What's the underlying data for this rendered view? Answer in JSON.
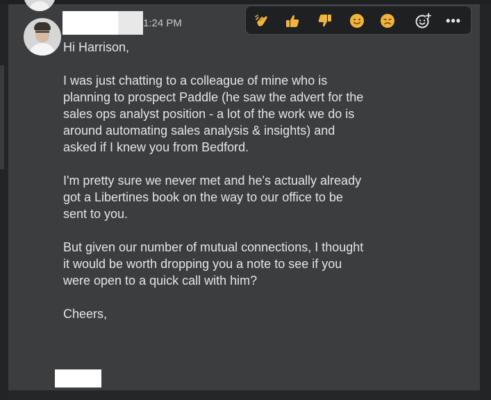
{
  "message": {
    "timestamp": "1:24 PM",
    "greeting": "Hi Harrison,",
    "paragraphs": [
      "I was just chatting to a colleague of mine who is\nplanning to prospect Paddle (he saw the advert for the\nsales ops analyst position - a lot of the work we do is\naround automating sales analysis & insights) and\nasked if I knew you from Bedford.",
      "I'm pretty sure we never met and he's actually already\ngot a Libertines book on the way to our office to be\nsent to you.",
      "But given our number of mutual connections, I thought\nit would be worth dropping you a note to see if you\nwere open to a quick call with him?"
    ],
    "signoff": "Cheers,"
  },
  "reactions": [
    {
      "icon": "clapping-hands-icon",
      "color": "#f2b43c"
    },
    {
      "icon": "thumbs-up-icon",
      "color": "#f2b43c"
    },
    {
      "icon": "thumbs-down-icon",
      "color": "#f2b43c"
    },
    {
      "icon": "smiley-face-icon",
      "color": "#f2b43c"
    },
    {
      "icon": "frowning-face-icon",
      "color": "#f2b43c"
    },
    {
      "icon": "add-reaction-icon",
      "color": "#e7e7e7"
    },
    {
      "icon": "more-options-icon",
      "color": "#e7e7e7"
    }
  ],
  "more_label": "•••"
}
